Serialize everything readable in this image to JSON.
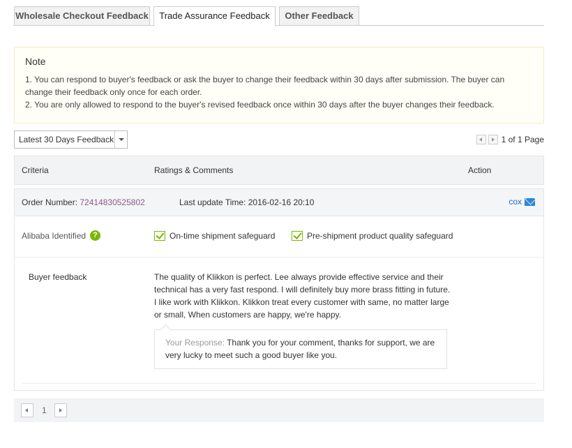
{
  "tabs": [
    {
      "label": "Wholesale Checkout Feedback",
      "active": false
    },
    {
      "label": "Trade Assurance Feedback",
      "active": true
    },
    {
      "label": "Other Feedback",
      "active": false
    }
  ],
  "note": {
    "title": "Note",
    "lines": [
      "1. You can respond to buyer's feedback or ask the buyer to change their feedback within 30 days after submission. The buyer can change their feedback only once for each order.",
      "2. You are only allowed to respond to the buyer's revised feedback once within 30 days after the buyer changes their feedback."
    ]
  },
  "filter": {
    "selected": "Latest 30 Days Feedback"
  },
  "pager_top": {
    "text": "1 of 1 Page"
  },
  "table_header": {
    "criteria": "Criteria",
    "ratings": "Ratings & Comments",
    "action": "Action"
  },
  "order": {
    "label": "Order Number: ",
    "number": "72414830525802",
    "update_label": "Last update Time: ",
    "update_time": "2016-02-16 20:10",
    "contact_name": "cox"
  },
  "identified": {
    "label": "Alibaba Identified",
    "help_glyph": "?",
    "safeguards": [
      "On-time shipment safeguard",
      "Pre-shipment product quality safeguard"
    ]
  },
  "feedback": {
    "label": "Buyer feedback",
    "text": "The quality of Klikkon is perfect. Lee always provide effective service and their technical has a very fast respond. I will definitely buy more brass fitting in future. I like work with Klikkon. Klikkon treat every customer with same, no matter large or small, When customers are happy, we're happy.",
    "response_label": "Your Response: ",
    "response_text": "Thank you for your comment, thanks for support, we are very lucky to meet such a good buyer like you."
  },
  "pager_bottom": {
    "page": "1"
  },
  "colors": {
    "accent_green": "#7ab800",
    "link_blue": "#1a6fb8",
    "order_purple": "#8a5a8a"
  }
}
